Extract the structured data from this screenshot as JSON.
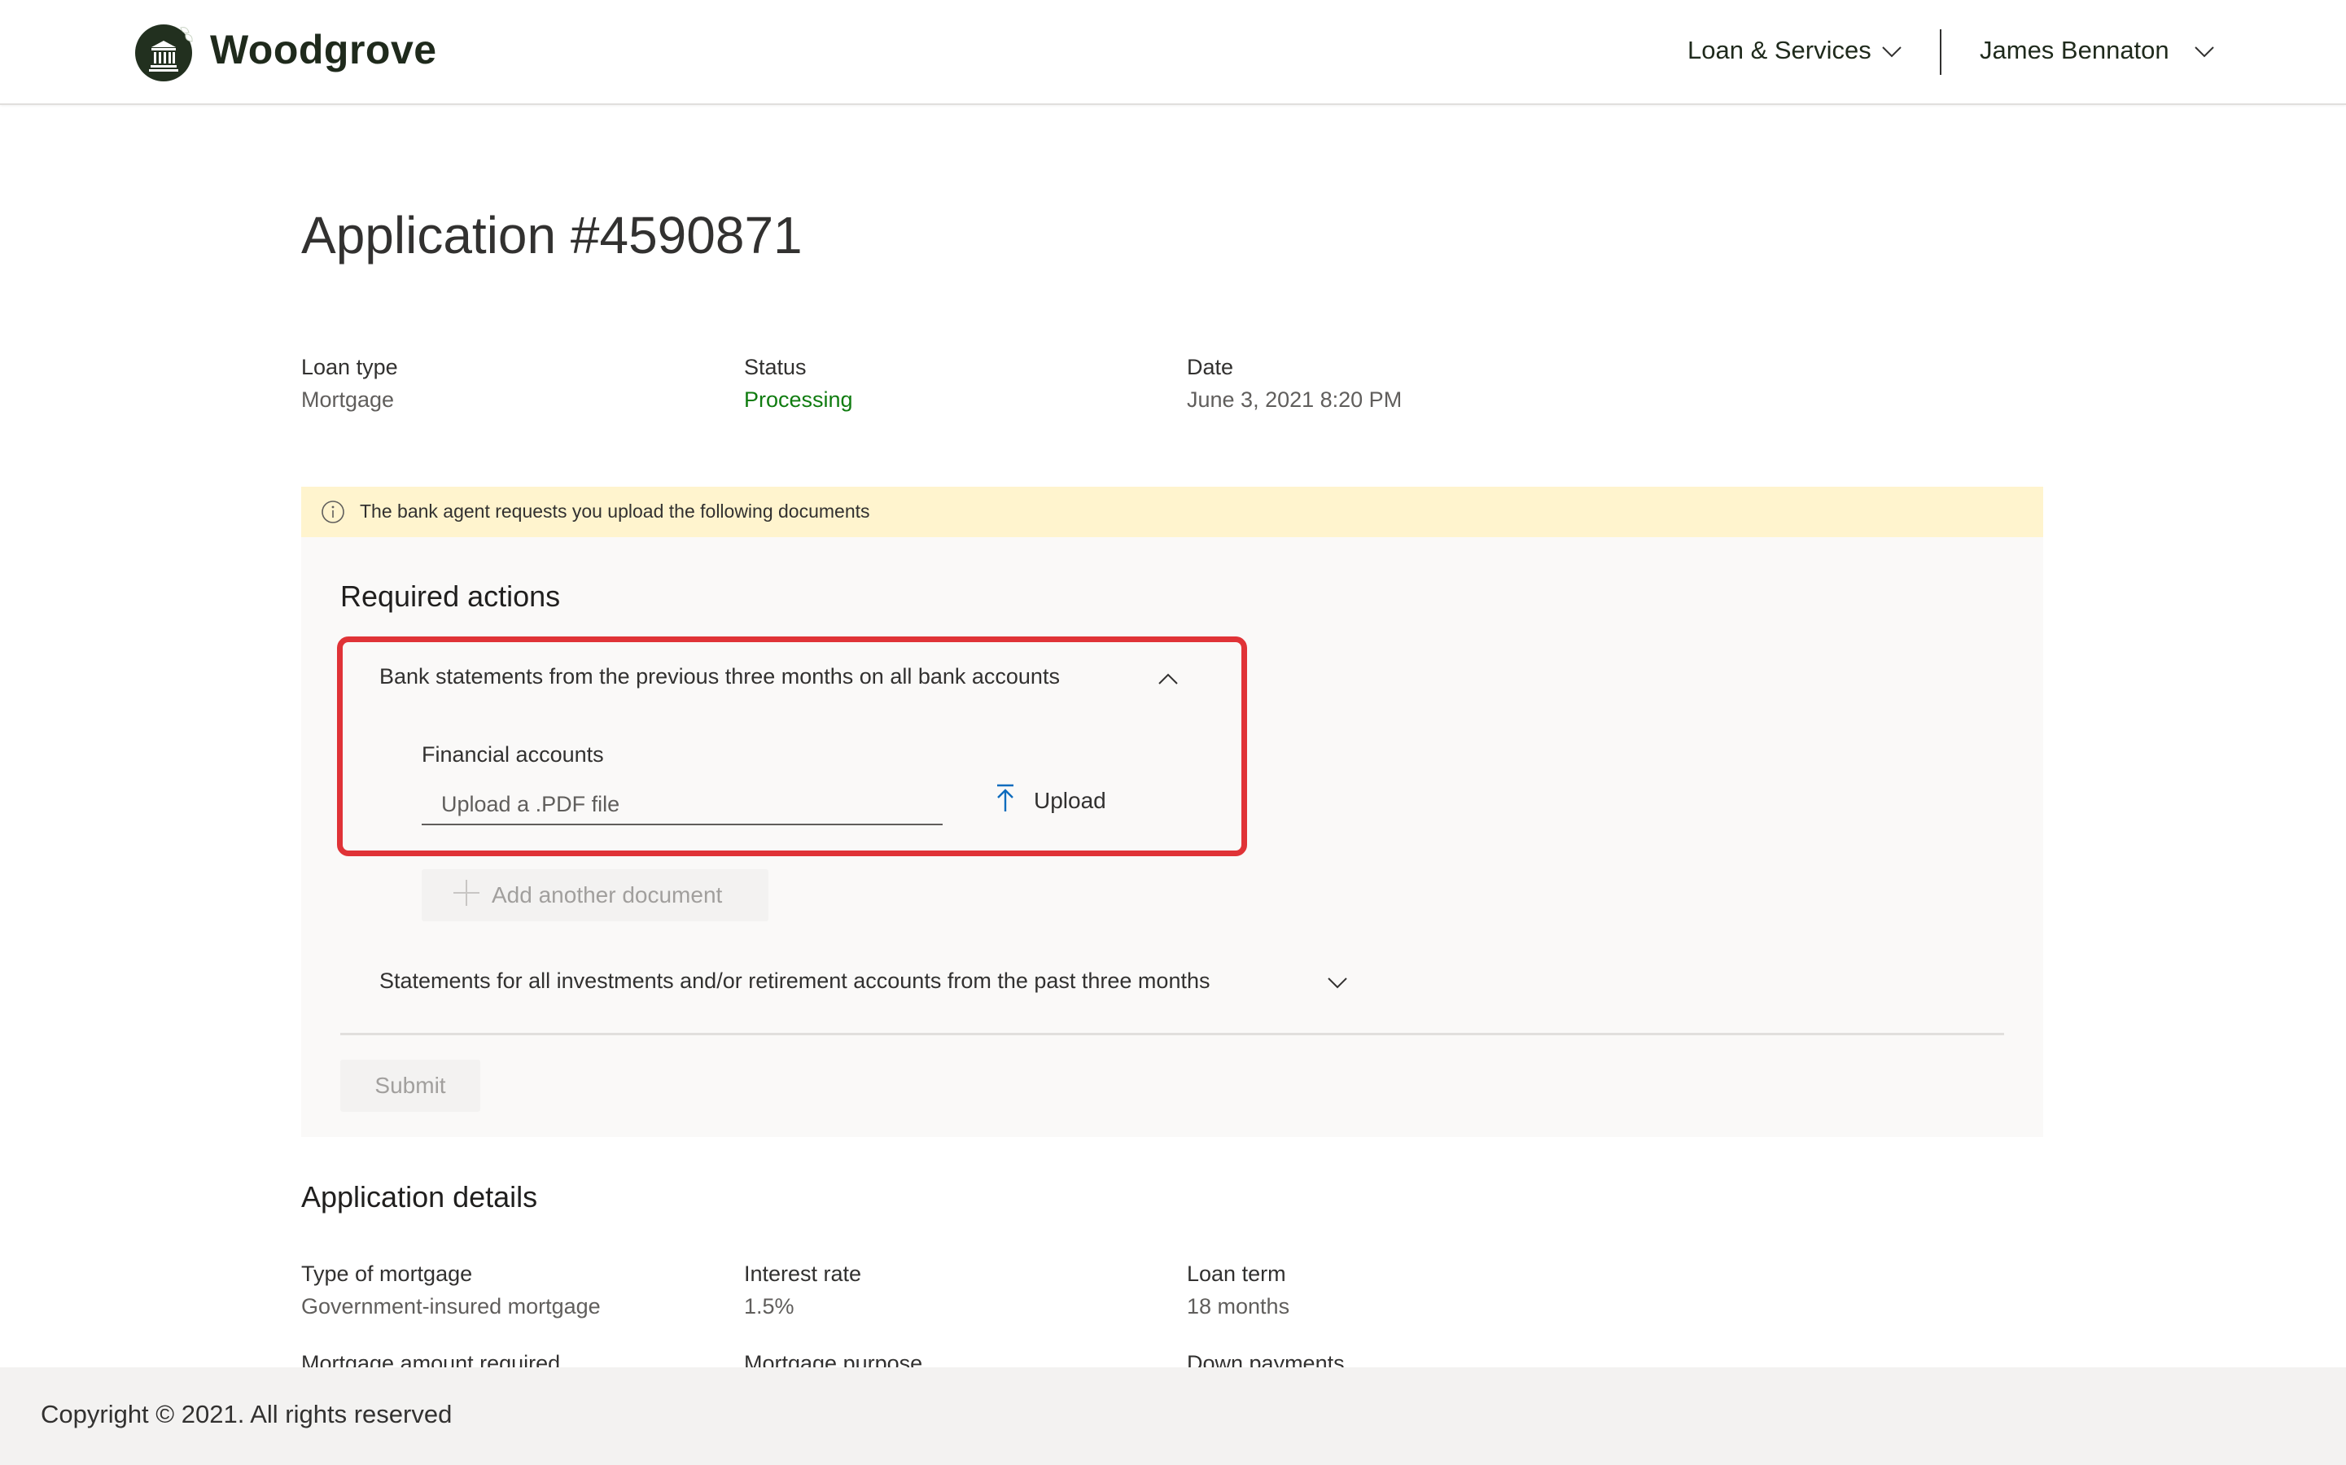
{
  "header": {
    "brand": "Woodgrove",
    "nav": [
      {
        "label": "Loan & Services",
        "icon": "chevron-down-icon"
      },
      {
        "label": "James Bennaton",
        "icon": "chevron-down-icon"
      }
    ]
  },
  "page": {
    "title": "Application #4590871"
  },
  "summary": {
    "fields": [
      {
        "label": "Loan type",
        "value": "Mortgage"
      },
      {
        "label": "Status",
        "value": "Processing"
      },
      {
        "label": "Date",
        "value": "June 3, 2021 8:20 PM"
      }
    ],
    "status_color": "#107c10"
  },
  "banner": {
    "icon": "info-icon",
    "text": "The bank agent requests you upload the following documents",
    "background": "#fff4ce"
  },
  "required_actions": {
    "title": "Required actions",
    "items": [
      {
        "title": "Bank statements from the previous three months on all bank accounts",
        "expanded": true,
        "icon": "chevron-up-icon",
        "field_label": "Financial accounts",
        "input_placeholder": "Upload a .PDF file",
        "input_value": "",
        "upload_label": "Upload",
        "upload_icon": "upload-arrow-icon",
        "add_document_label": "Add another document",
        "highlighted": true
      },
      {
        "title": "Statements for all investments and/or retirement accounts from the past three months",
        "expanded": false,
        "icon": "chevron-down-icon"
      }
    ],
    "submit_label": "Submit",
    "highlight_color": "#e03337",
    "accent_color": "#0f6cbd"
  },
  "application_details": {
    "title": "Application details",
    "fields": [
      {
        "label": "Type of mortgage",
        "value": "Government-insured mortgage"
      },
      {
        "label": "Interest rate",
        "value": "1.5%"
      },
      {
        "label": "Loan term",
        "value": "18 months"
      },
      {
        "label": "Mortgage amount required",
        "value": ""
      },
      {
        "label": "Mortgage purpose",
        "value": ""
      },
      {
        "label": "Down payments",
        "value": ""
      }
    ]
  },
  "footer": {
    "copyright": "Copyright © 2021. All rights reserved"
  }
}
